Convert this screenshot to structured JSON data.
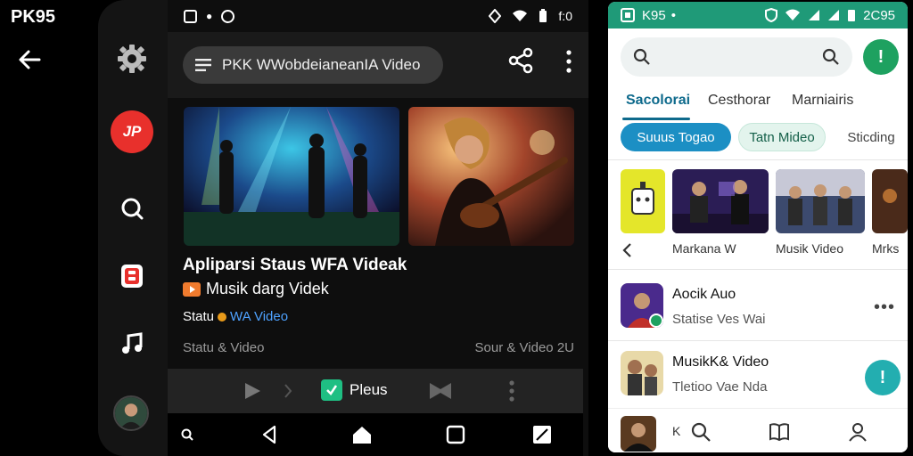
{
  "left": {
    "title": "PK95"
  },
  "dark_panel": {
    "status_time": "f:0",
    "search_text": "PKK WWobdeianeanIA Video",
    "video": {
      "title": "Apliparsi Staus WFA Videak",
      "subtitle": "Musik darg Videk",
      "status_prefix": "Statu",
      "status_link": "WA Video",
      "meta_left": "Statu & Video",
      "meta_right": "Sour & Video 2U"
    },
    "player": {
      "plus_label": "Pleus"
    }
  },
  "rail": {
    "red_badge": "JP"
  },
  "light_panel": {
    "status_title": "K95",
    "status_time": "2Ϲ95",
    "tabs": [
      "Sacolorai",
      "Cesthorar",
      "Marniairis"
    ],
    "chips": [
      "Suuus Togao",
      "Tatn Mideo",
      "Sticding"
    ],
    "card_labels": [
      "Markana W",
      "Musik Video",
      "Mrks"
    ],
    "list": [
      {
        "title": "Aocik Auo",
        "subtitle": "Statise Ves Wai"
      },
      {
        "title": "MusikK& Video",
        "subtitle": "Tletioo Vae Nda"
      },
      {
        "title": "K"
      }
    ]
  },
  "colors": {
    "accent_green": "#1f9a78",
    "accent_blue": "#1c8fc4",
    "red": "#e8302c"
  },
  "icons": [
    "back-arrow-icon",
    "gear-icon",
    "search-icon",
    "share-icon",
    "more-vert-icon",
    "play-icon",
    "home-icon",
    "square-icon",
    "music-note-icon",
    "user-icon",
    "book-icon"
  ]
}
